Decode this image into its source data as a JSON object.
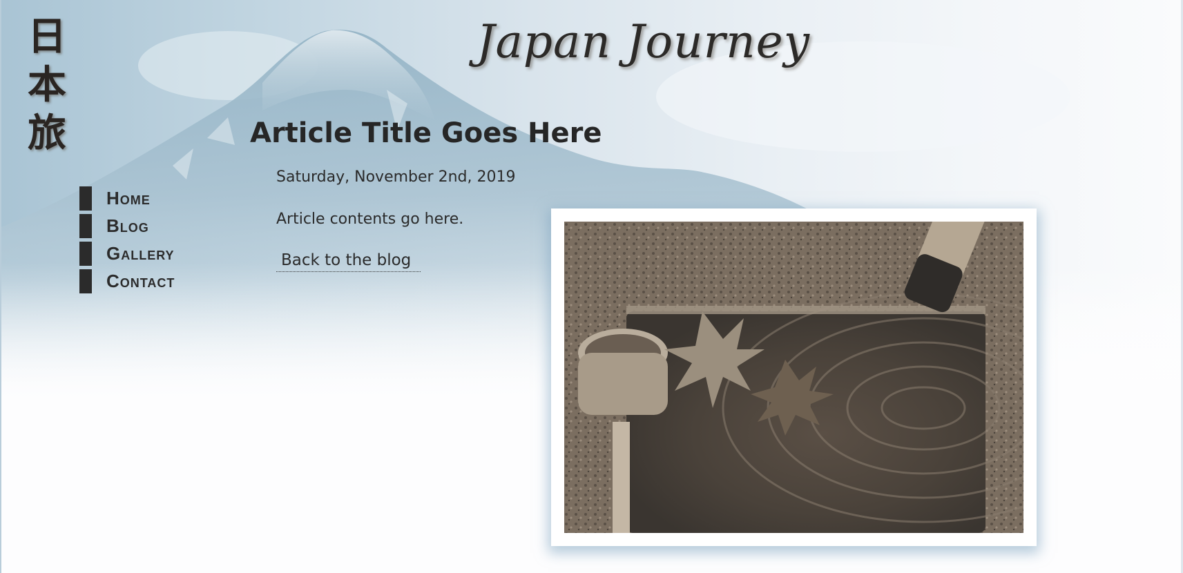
{
  "logo": {
    "kanji": [
      "日",
      "本",
      "旅"
    ]
  },
  "site": {
    "title": "Japan Journey"
  },
  "nav": {
    "items": [
      {
        "label": "Home"
      },
      {
        "label": "Blog"
      },
      {
        "label": "Gallery"
      },
      {
        "label": "Contact"
      }
    ]
  },
  "article": {
    "title": "Article Title Goes Here",
    "date": "Saturday, November 2nd, 2019",
    "body": "Article contents go here.",
    "back_link": "Back to the blog"
  },
  "colors": {
    "text": "#2b2b2b",
    "sky": "#a9c4d4",
    "frame_shadow": "#7aa0be"
  },
  "icons": {
    "hero": "mount-fuji-image",
    "photo": "water-basin-with-maple-leaves-image"
  }
}
